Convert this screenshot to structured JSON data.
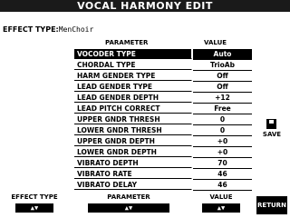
{
  "title": "VOCAL HARMONY EDIT",
  "effect_type": {
    "label": "EFFECT TYPE:",
    "value": "MenChoir"
  },
  "columns": {
    "parameter": "PARAMETER",
    "value": "VALUE"
  },
  "rows": [
    {
      "param": "VOCODER TYPE",
      "value": "Auto",
      "selected": true
    },
    {
      "param": "CHORDAL TYPE",
      "value": "TrioAb"
    },
    {
      "param": "HARM GENDER TYPE",
      "value": "Off"
    },
    {
      "param": "LEAD GENDER TYPE",
      "value": "Off"
    },
    {
      "param": "LEAD GENDER DEPTH",
      "value": "+12"
    },
    {
      "param": "LEAD PITCH CORRECT",
      "value": "Free"
    },
    {
      "param": "UPPER GNDR THRESH",
      "value": "0"
    },
    {
      "param": "LOWER GNDR THRESH",
      "value": "0"
    },
    {
      "param": "UPPER GNDR DEPTH",
      "value": "+0"
    },
    {
      "param": "LOWER GNDR DEPTH",
      "value": "+0"
    },
    {
      "param": "VIBRATO DEPTH",
      "value": "70"
    },
    {
      "param": "VIBRATO RATE",
      "value": "46"
    },
    {
      "param": "VIBRATO DELAY",
      "value": "46"
    }
  ],
  "save_label": "SAVE",
  "bottom": {
    "effect_type": "EFFECT TYPE",
    "parameter": "PARAMETER",
    "value": "VALUE",
    "arrows": "▲▼",
    "return": "RETURN"
  },
  "icons": {
    "save": "floppy-disk-icon",
    "updown": "up-down-arrows-icon"
  }
}
